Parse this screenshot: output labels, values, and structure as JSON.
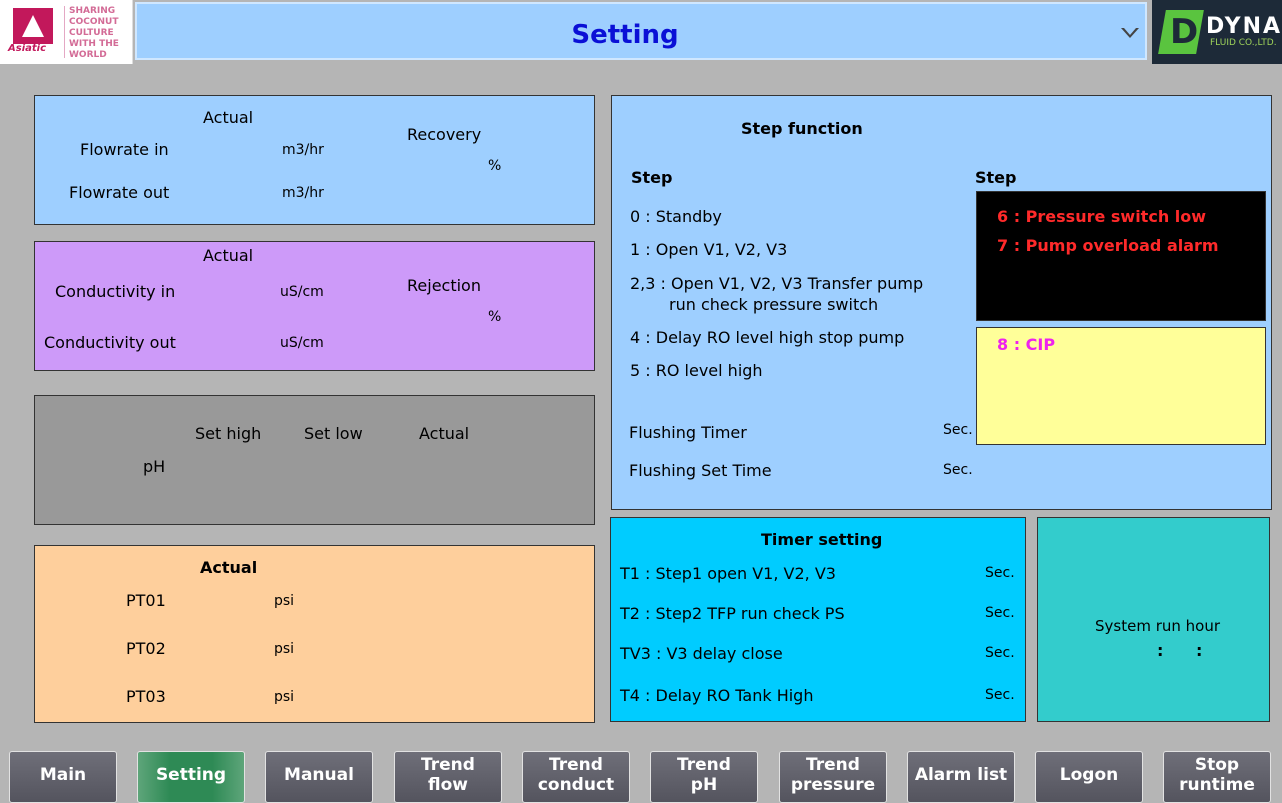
{
  "header": {
    "title": "Setting",
    "left_logo": {
      "brand": "Asiatic",
      "tagline": "SHARING COCONUT CULTURE WITH THE WORLD"
    },
    "right_logo": {
      "name": "DYNA",
      "sub": "FLUID CO.,LTD."
    }
  },
  "flow": {
    "actual": "Actual",
    "recovery": "Recovery",
    "flow_in": "Flowrate in",
    "flow_out": "Flowrate out",
    "unit": "m3/hr",
    "percent": "%"
  },
  "conductivity": {
    "actual": "Actual",
    "rejection": "Rejection",
    "cond_in": "Conductivity in",
    "cond_out": "Conductivity out",
    "unit": "uS/cm",
    "percent": "%"
  },
  "ph": {
    "set_high": "Set high",
    "set_low": "Set low",
    "actual": "Actual",
    "label": "pH"
  },
  "pressure": {
    "actual": "Actual",
    "unit": "psi",
    "rows": [
      "PT01",
      "PT02",
      "PT03"
    ]
  },
  "step_function": {
    "title": "Step function",
    "step_label": "Step",
    "step_label_right": "Step",
    "steps": [
      "0 : Standby",
      "1 : Open V1, V2, V3",
      "2,3 : Open V1, V2, V3 Transfer pump",
      "run check pressure switch",
      "4 : Delay RO level high stop pump",
      "5 : RO level high"
    ],
    "alarms": [
      "6 : Pressure switch low",
      "7 : Pump overload alarm"
    ],
    "cip": "8 : CIP",
    "flushing_timer": "Flushing Timer",
    "flushing_set_time": "Flushing Set Time",
    "sec": "Sec."
  },
  "timer_setting": {
    "title": "Timer setting",
    "sec": "Sec.",
    "rows": [
      "T1 : Step1 open V1, V2, V3",
      "T2 : Step2 TFP run check PS",
      "TV3 : V3 delay close",
      "T4 : Delay RO Tank High"
    ]
  },
  "run_hour": {
    "label": "System run hour",
    "colon": ":"
  },
  "nav": [
    {
      "label": "Main"
    },
    {
      "label": "Setting",
      "active": true
    },
    {
      "label": "Manual"
    },
    {
      "label": "Trend\nflow"
    },
    {
      "label": "Trend\nconduct"
    },
    {
      "label": "Trend\npH"
    },
    {
      "label": "Trend\npressure"
    },
    {
      "label": "Alarm list"
    },
    {
      "label": "Logon"
    },
    {
      "label": "Stop\nruntime"
    }
  ],
  "colors": {
    "title_text": "#0a10d6",
    "flow_panel": "#9ecfff",
    "cond_panel": "#cd9af9",
    "ph_panel": "#999999",
    "pressure_panel": "#fecf9c",
    "timer_panel": "#00ccff",
    "runhour_panel": "#33cccc",
    "alarm_text": "#ff2a2a",
    "cip_text": "#ee22ee",
    "nav_active": "#2e8a55"
  }
}
